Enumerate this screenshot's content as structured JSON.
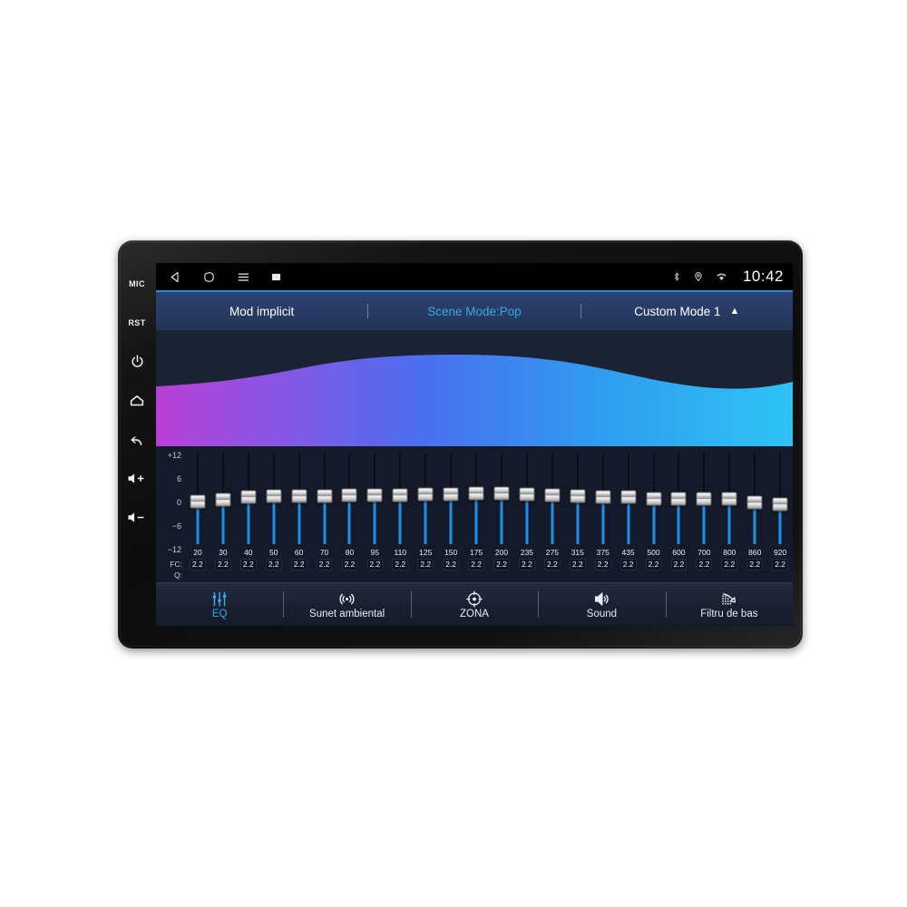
{
  "device": {
    "hw_keys": [
      {
        "name": "mic-button",
        "label": "MIC",
        "icon": "text"
      },
      {
        "name": "reset-button",
        "label": "RST",
        "icon": "text"
      },
      {
        "name": "power-button",
        "label": "",
        "icon": "power-icon"
      },
      {
        "name": "home-button",
        "label": "",
        "icon": "home-icon"
      },
      {
        "name": "back-button",
        "label": "",
        "icon": "back-arrow-icon"
      },
      {
        "name": "volume-up-button",
        "label": "+",
        "icon": "speaker-plus-icon"
      },
      {
        "name": "volume-down-button",
        "label": "-",
        "icon": "speaker-minus-icon"
      }
    ]
  },
  "statusbar": {
    "nav_icons": [
      "back-triangle-icon",
      "home-squircle-icon",
      "menu-hamburger-icon",
      "screenshot-icon"
    ],
    "sys_icons": [
      "bluetooth-icon",
      "location-pin-icon",
      "wifi-icon"
    ],
    "clock": "10:42"
  },
  "modebar": {
    "tabs": [
      {
        "label": "Mod implicit",
        "accent": false
      },
      {
        "label": "Scene Mode:Pop",
        "accent": true
      },
      {
        "label": "Custom Mode 1",
        "accent": false,
        "caret": "▲"
      }
    ]
  },
  "eq": {
    "db_scale": [
      "+12",
      "6",
      "0",
      "−6",
      "−12"
    ],
    "row_label_fc": "FC:",
    "row_label_q": "Q:",
    "bands": [
      {
        "fc": "20",
        "q": "2.2",
        "gain": -0.8
      },
      {
        "fc": "30",
        "q": "2.2",
        "gain": -0.2
      },
      {
        "fc": "40",
        "q": "2.2",
        "gain": 0.4
      },
      {
        "fc": "50",
        "q": "2.2",
        "gain": 0.7
      },
      {
        "fc": "60",
        "q": "2.2",
        "gain": 0.7
      },
      {
        "fc": "70",
        "q": "2.2",
        "gain": 0.8
      },
      {
        "fc": "80",
        "q": "2.2",
        "gain": 0.9
      },
      {
        "fc": "95",
        "q": "2.2",
        "gain": 1.0
      },
      {
        "fc": "110",
        "q": "2.2",
        "gain": 1.1
      },
      {
        "fc": "125",
        "q": "2.2",
        "gain": 1.2
      },
      {
        "fc": "150",
        "q": "2.2",
        "gain": 1.3
      },
      {
        "fc": "175",
        "q": "2.2",
        "gain": 1.4
      },
      {
        "fc": "200",
        "q": "2.2",
        "gain": 1.5
      },
      {
        "fc": "235",
        "q": "2.2",
        "gain": 1.3
      },
      {
        "fc": "275",
        "q": "2.2",
        "gain": 1.1
      },
      {
        "fc": "315",
        "q": "2.2",
        "gain": 0.8
      },
      {
        "fc": "375",
        "q": "2.2",
        "gain": 0.6
      },
      {
        "fc": "435",
        "q": "2.2",
        "gain": 0.4
      },
      {
        "fc": "500",
        "q": "2.2",
        "gain": 0.1
      },
      {
        "fc": "600",
        "q": "2.2",
        "gain": 0.0
      },
      {
        "fc": "700",
        "q": "2.2",
        "gain": -0.1
      },
      {
        "fc": "800",
        "q": "2.2",
        "gain": 0.0
      },
      {
        "fc": "860",
        "q": "2.2",
        "gain": -1.0
      },
      {
        "fc": "920",
        "q": "2.2",
        "gain": -1.6
      }
    ],
    "curve_colors": {
      "left": "#b93fd6",
      "mid": "#4a6ff0",
      "right": "#2ec3f5"
    },
    "accent": "#37a8e8",
    "track_fill": "#1e90e8"
  },
  "bottomnav": {
    "items": [
      {
        "label": "EQ",
        "icon": "equalizer-icon",
        "active": true
      },
      {
        "label": "Sunet ambiental",
        "icon": "surround-icon",
        "active": false
      },
      {
        "label": "ZONA",
        "icon": "zone-target-icon",
        "active": false
      },
      {
        "label": "Sound",
        "icon": "speaker-icon",
        "active": false
      },
      {
        "label": "Filtru de bas",
        "icon": "bass-filter-icon",
        "active": false
      }
    ]
  }
}
